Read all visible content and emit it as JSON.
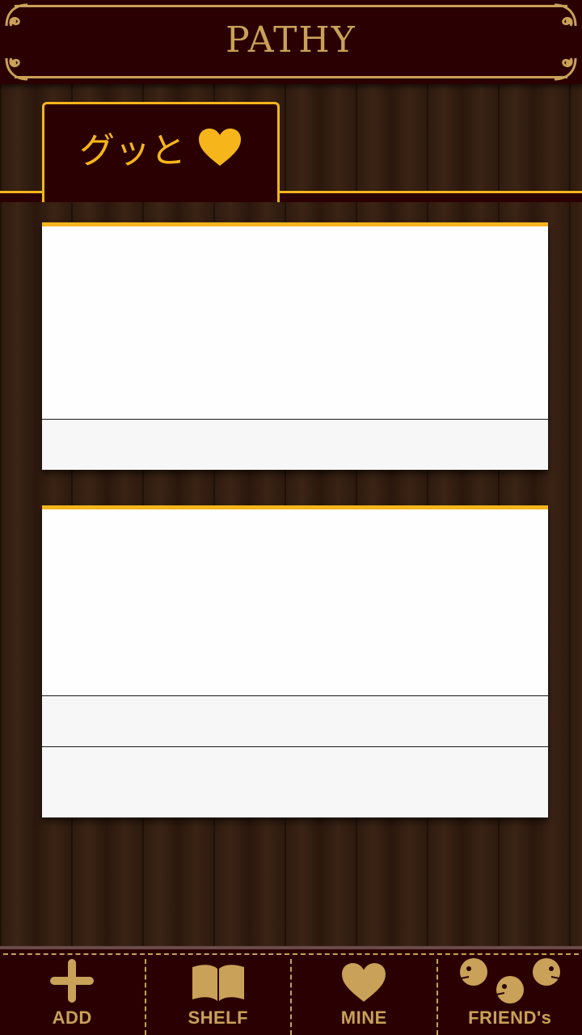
{
  "app": {
    "title": "PATHY"
  },
  "tabs": [
    {
      "label": "グッと",
      "icon": "heart-icon",
      "selected": true
    }
  ],
  "cards": [
    {
      "rows": 1
    },
    {
      "rows": 2
    }
  ],
  "bottom_nav": {
    "items": [
      {
        "label": "ADD",
        "icon": "plus-icon"
      },
      {
        "label": "SHELF",
        "icon": "book-icon"
      },
      {
        "label": "MINE",
        "icon": "heart-icon"
      },
      {
        "label": "FRIEND's",
        "icon": "friends-icon"
      }
    ]
  },
  "colors": {
    "header_bg": "#2a0003",
    "gold": "#c9a158",
    "accent_yellow": "#f5b51b",
    "card_bg": "#fefefe"
  }
}
